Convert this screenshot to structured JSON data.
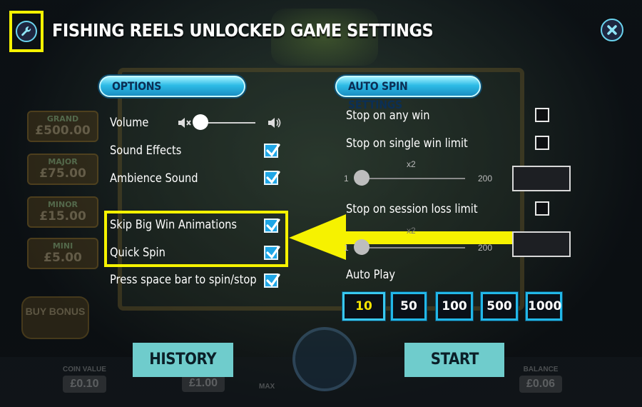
{
  "header": {
    "title": "FISHING REELS UNLOCKED GAME SETTINGS",
    "settings_icon": "wrench-icon",
    "close_icon": "close-icon"
  },
  "background": {
    "jackpots": [
      {
        "name": "GRAND",
        "value": "£500.00"
      },
      {
        "name": "MAJOR",
        "value": "£75.00"
      },
      {
        "name": "MINOR",
        "value": "£15.00"
      },
      {
        "name": "MINI",
        "value": "£5.00"
      }
    ],
    "buy_bonus": "BUY BONUS",
    "coin_value_label": "COIN VALUE",
    "coin_value": "£0.10",
    "bet_value": "£1.00",
    "max_label": "MAX",
    "balance_label": "BALANCE",
    "balance": "£0.06"
  },
  "options": {
    "header": "OPTIONS",
    "volume_label": "Volume",
    "volume_level": 0.1,
    "items": [
      {
        "label": "Sound Effects",
        "checked": true
      },
      {
        "label": "Ambience Sound",
        "checked": true
      },
      {
        "label": "Skip Big Win Animations",
        "checked": true
      },
      {
        "label": "Quick Spin",
        "checked": true
      },
      {
        "label": "Press space bar to spin/stop",
        "checked": true
      }
    ]
  },
  "auto_spin": {
    "header": "AUTO SPIN SETTINGS",
    "stop_any_win": {
      "label": "Stop on any win",
      "checked": false
    },
    "stop_single_win": {
      "label": "Stop on single win limit",
      "checked": false
    },
    "single_win_slider": {
      "min": "1",
      "max": "200",
      "multiplier": "x2",
      "value": ""
    },
    "stop_session_loss": {
      "label": "Stop on session loss limit",
      "checked": false
    },
    "session_loss_slider": {
      "min": "1",
      "max": "200",
      "multiplier": "x2",
      "value": ""
    },
    "auto_play_label": "Auto Play",
    "auto_play_options": [
      "10",
      "50",
      "100",
      "500",
      "1000"
    ],
    "auto_play_selected": "10"
  },
  "footer": {
    "history_label": "HISTORY",
    "start_label": "START"
  },
  "colors": {
    "highlight": "#f6f200",
    "accent": "#22b7e8",
    "button_bg": "#6fcccc",
    "checkbox_checked": "#1fa6e6"
  }
}
